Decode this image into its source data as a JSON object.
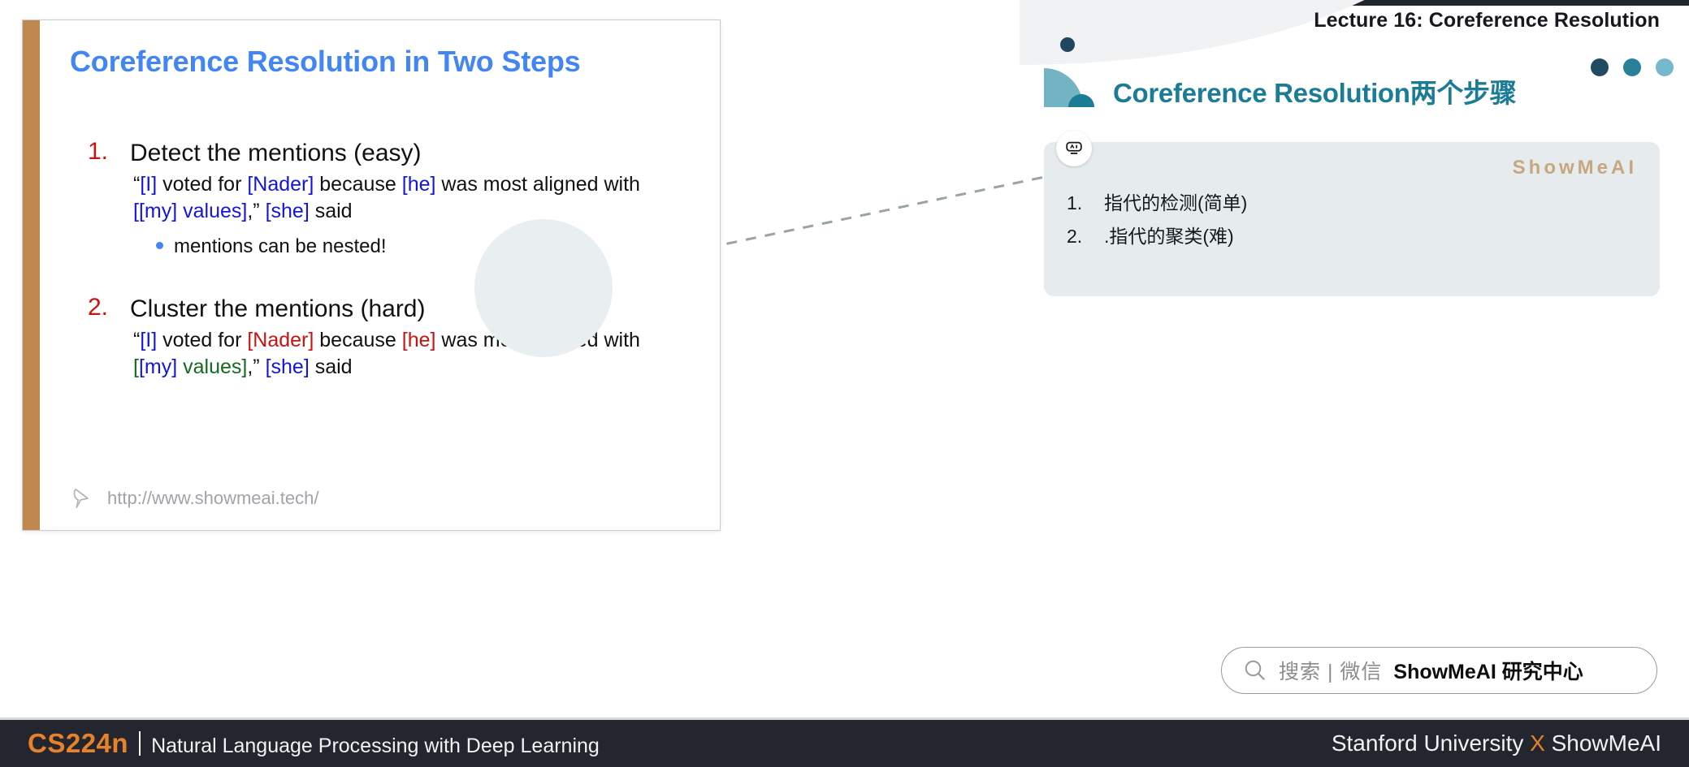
{
  "header": {
    "lecture_title": "Lecture 16: Coreference Resolution"
  },
  "slide": {
    "title": "Coreference Resolution in Two Steps",
    "items": [
      {
        "marker": "1.",
        "heading": "Detect the mentions (easy)",
        "quote_line1_parts": [
          {
            "t": "“",
            "c": "black"
          },
          {
            "t": "[I]",
            "c": "blue"
          },
          {
            "t": " voted for ",
            "c": "black"
          },
          {
            "t": "[Nader]",
            "c": "blue"
          },
          {
            "t": " because ",
            "c": "black"
          },
          {
            "t": "[he]",
            "c": "blue"
          },
          {
            "t": " was most aligned with",
            "c": "black"
          }
        ],
        "quote_line2_parts": [
          {
            "t": "[",
            "c": "blue"
          },
          {
            "t": "[my]",
            "c": "blue"
          },
          {
            "t": " values]",
            "c": "blue"
          },
          {
            "t": ",” ",
            "c": "black"
          },
          {
            "t": "[she]",
            "c": "blue"
          },
          {
            "t": " said",
            "c": "black"
          }
        ],
        "sub_bullet": "mentions can be nested!"
      },
      {
        "marker": "2.",
        "heading": "Cluster the mentions (hard)",
        "quote_line1_parts": [
          {
            "t": "“",
            "c": "black"
          },
          {
            "t": "[I]",
            "c": "blue"
          },
          {
            "t": " voted for ",
            "c": "black"
          },
          {
            "t": "[Nader]",
            "c": "red"
          },
          {
            "t": " because ",
            "c": "black"
          },
          {
            "t": "[he]",
            "c": "red"
          },
          {
            "t": " was most aligned with",
            "c": "black"
          }
        ],
        "quote_line2_parts": [
          {
            "t": "[",
            "c": "green"
          },
          {
            "t": "[my]",
            "c": "blue"
          },
          {
            "t": " values]",
            "c": "green"
          },
          {
            "t": ",” ",
            "c": "black"
          },
          {
            "t": "[she]",
            "c": "blue"
          },
          {
            "t": " said",
            "c": "black"
          }
        ],
        "sub_bullet": ""
      }
    ],
    "footer_url": "http://www.showmeai.tech/",
    "accent_color": "#c0884f",
    "title_color": "#4285f4"
  },
  "annotation": {
    "title": "Coreference Resolution两个步骤",
    "watermark": "ShowMeAI",
    "ai_badge_label": "AI",
    "rows": [
      {
        "index": "1.",
        "text": "指代的检测(简单)"
      },
      {
        "index": "2.",
        "text": ".指代的聚类(难)"
      }
    ],
    "dot_colors": [
      "#214a63",
      "#2a8099",
      "#77b9cc"
    ],
    "panel_bg": "#e6eced",
    "title_color": "#1b7c96"
  },
  "search_pill": {
    "grey_text": "搜索 | 微信",
    "bold_text": "ShowMeAI 研究中心"
  },
  "bottom_bar": {
    "course_code": "CS224n",
    "course_name": "Natural Language Processing with Deep Learning",
    "right_pre": "Stanford University ",
    "right_x": "X",
    "right_post": " ShowMeAI",
    "accent_color": "#e8822a",
    "bg_color": "#23262e"
  }
}
